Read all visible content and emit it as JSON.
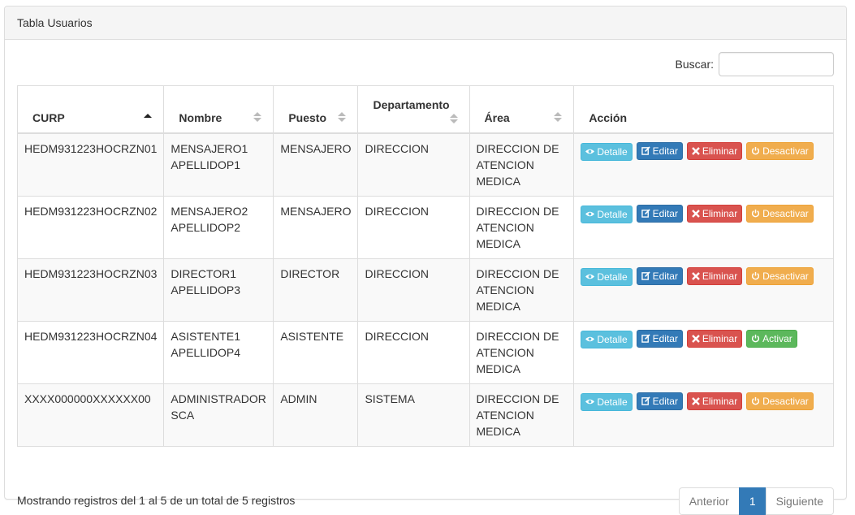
{
  "panel": {
    "title": "Tabla Usuarios"
  },
  "search": {
    "label": "Buscar:",
    "value": ""
  },
  "table": {
    "headers": [
      "CURP",
      "Nombre",
      "Puesto",
      "Departamento",
      "Área",
      "Acción"
    ],
    "rows": [
      {
        "curp": "HEDM931223HOCRZN01",
        "nombre": "MENSAJERO1 APELLIDOP1",
        "puesto": "MENSAJERO",
        "departamento": "DIRECCION",
        "area": "DIRECCION DE ATENCION MEDICA",
        "toggle": "Desactivar"
      },
      {
        "curp": "HEDM931223HOCRZN02",
        "nombre": "MENSAJERO2 APELLIDOP2",
        "puesto": "MENSAJERO",
        "departamento": "DIRECCION",
        "area": "DIRECCION DE ATENCION MEDICA",
        "toggle": "Desactivar"
      },
      {
        "curp": "HEDM931223HOCRZN03",
        "nombre": "DIRECTOR1 APELLIDOP3",
        "puesto": "DIRECTOR",
        "departamento": "DIRECCION",
        "area": "DIRECCION DE ATENCION MEDICA",
        "toggle": "Desactivar"
      },
      {
        "curp": "HEDM931223HOCRZN04",
        "nombre": "ASISTENTE1 APELLIDOP4",
        "puesto": "ASISTENTE",
        "departamento": "DIRECCION",
        "area": "DIRECCION DE ATENCION MEDICA",
        "toggle": "Activar"
      },
      {
        "curp": "XXXX000000XXXXXX00",
        "nombre": "ADMINISTRADOR SCA",
        "puesto": "ADMIN",
        "departamento": "SISTEMA",
        "area": "DIRECCION DE ATENCION MEDICA",
        "toggle": "Desactivar"
      }
    ],
    "actions": {
      "detalle": "Detalle",
      "editar": "Editar",
      "eliminar": "Eliminar"
    }
  },
  "footer": {
    "info": "Mostrando registros del 1 al 5 de un total de 5 registros",
    "prev": "Anterior",
    "page": "1",
    "next": "Siguiente"
  },
  "colors": {
    "info": "#5bc0de",
    "primary": "#337ab7",
    "danger": "#d9534f",
    "warning": "#f0ad4e",
    "success": "#5cb85c"
  }
}
